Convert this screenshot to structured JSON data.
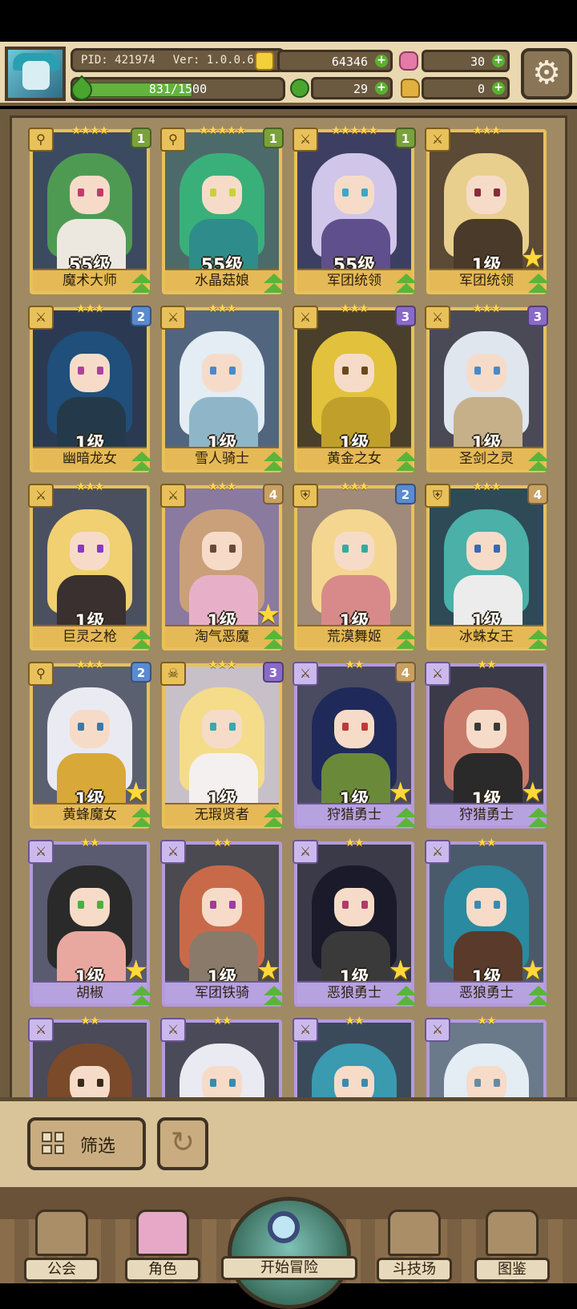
{
  "header": {
    "pid": "PID: 421974",
    "version": "Ver: 1.0.0.6",
    "exp_text": "831/1500",
    "exp_progress": 0.554,
    "resources": {
      "gold": "64346",
      "gems": "30",
      "clover": "29",
      "shoe": "0"
    }
  },
  "roster": [
    {
      "name": "魔术大师",
      "level": "55级",
      "stars": "★★★★",
      "rank": "1",
      "rank_color": "#7aa23c",
      "frame": "gold",
      "type_icon": "wrench",
      "hair": "#4f9a52",
      "body": "#ece8e0",
      "eye": "#c23a6c",
      "bg": "#3b4a60",
      "gold_star": false
    },
    {
      "name": "水晶菇娘",
      "level": "55级",
      "stars": "★★★★★",
      "rank": "1",
      "rank_color": "#7aa23c",
      "frame": "gold",
      "type_icon": "wrench",
      "hair": "#39b07a",
      "body": "#2e8d8a",
      "eye": "#c8d23a",
      "bg": "#4d6a6a",
      "gold_star": false
    },
    {
      "name": "军团统领",
      "level": "55级",
      "stars": "★★★★★",
      "rank": "1",
      "rank_color": "#7aa23c",
      "frame": "gold",
      "type_icon": "sword",
      "hair": "#cfc6ea",
      "body": "#5f4f8c",
      "eye": "#3aa8c8",
      "bg": "#3d3f62",
      "gold_star": false
    },
    {
      "name": "军团统领",
      "level": "1级",
      "stars": "★★★",
      "rank": "",
      "rank_color": "",
      "frame": "gold",
      "type_icon": "sword",
      "hair": "#e8cf8e",
      "body": "#4a3a2a",
      "eye": "#8a2a3a",
      "bg": "#5a4a36",
      "gold_star": true
    },
    {
      "name": "幽暗龙女",
      "level": "1级",
      "stars": "★★★",
      "rank": "2",
      "rank_color": "#5a8ad0",
      "frame": "gold",
      "type_icon": "sword",
      "hair": "#1f4f7a",
      "body": "#243a4a",
      "eye": "#b040a0",
      "bg": "#2b3a52",
      "gold_star": false
    },
    {
      "name": "雪人骑士",
      "level": "1级",
      "stars": "★★★",
      "rank": "",
      "rank_color": "",
      "frame": "gold",
      "type_icon": "sword",
      "hair": "#e4ecf4",
      "body": "#8fb6c8",
      "eye": "#4a8ac8",
      "bg": "#51667e",
      "gold_star": false
    },
    {
      "name": "黄金之女",
      "level": "1级",
      "stars": "★★★",
      "rank": "3",
      "rank_color": "#8a6ac8",
      "frame": "gold",
      "type_icon": "sword",
      "hair": "#e2c23c",
      "body": "#c0a02a",
      "eye": "#6a4a1a",
      "bg": "#4a3f2a",
      "gold_star": false
    },
    {
      "name": "圣剑之灵",
      "level": "1级",
      "stars": "★★★",
      "rank": "3",
      "rank_color": "#8a6ac8",
      "frame": "gold",
      "type_icon": "sword",
      "hair": "#dfe6ee",
      "body": "#c6b08a",
      "eye": "#4a8ac8",
      "bg": "#4a4a56",
      "gold_star": false
    },
    {
      "name": "巨灵之枪",
      "level": "1级",
      "stars": "★★★",
      "rank": "",
      "rank_color": "",
      "frame": "gold",
      "type_icon": "sword",
      "hair": "#f0d070",
      "body": "#3a3030",
      "eye": "#8a3ac0",
      "bg": "#4a5060",
      "gold_star": false
    },
    {
      "name": "淘气恶魔",
      "level": "1级",
      "stars": "★★★",
      "rank": "4",
      "rank_color": "#c8a060",
      "frame": "gold",
      "type_icon": "sword",
      "hair": "#c9a07a",
      "body": "#e8b0c8",
      "eye": "#6a4a3a",
      "bg": "#8a7aa0",
      "gold_star": true
    },
    {
      "name": "荒漠舞姬",
      "level": "1级",
      "stars": "★★★",
      "rank": "2",
      "rank_color": "#5a8ad0",
      "frame": "gold",
      "type_icon": "shield",
      "hair": "#f4d690",
      "body": "#d88a8a",
      "eye": "#3aa8a0",
      "bg": "#a08a7a",
      "gold_star": false
    },
    {
      "name": "冰蛛女王",
      "level": "1级",
      "stars": "★★★",
      "rank": "4",
      "rank_color": "#c8a060",
      "frame": "gold",
      "type_icon": "shield",
      "hair": "#4ab0a8",
      "body": "#ececec",
      "eye": "#3a6ab0",
      "bg": "#2e4a56",
      "gold_star": false
    },
    {
      "name": "黄蜂魔女",
      "level": "1级",
      "stars": "★★★",
      "rank": "2",
      "rank_color": "#5a8ad0",
      "frame": "gold",
      "type_icon": "wrench",
      "hair": "#eaeaf2",
      "body": "#d8a838",
      "eye": "#3a7ab0",
      "bg": "#5a6070",
      "gold_star": true
    },
    {
      "name": "无瑕贤者",
      "level": "1级",
      "stars": "★★★",
      "rank": "3",
      "rank_color": "#8a6ac8",
      "frame": "gold",
      "type_icon": "skull",
      "hair": "#f4dc8a",
      "body": "#f4f0f0",
      "eye": "#3aa8b0",
      "bg": "#c8c0c8",
      "gold_star": false
    },
    {
      "name": "狩猎勇士",
      "level": "1级",
      "stars": "★★",
      "rank": "4",
      "rank_color": "#c8a060",
      "frame": "purple",
      "type_icon": "sword",
      "hair": "#1f2a5a",
      "body": "#6a8a3a",
      "eye": "#c03a3a",
      "bg": "#4a4a60",
      "gold_star": true
    },
    {
      "name": "狩猎勇士",
      "level": "1级",
      "stars": "★★",
      "rank": "",
      "rank_color": "",
      "frame": "purple",
      "type_icon": "sword",
      "hair": "#c87a6a",
      "body": "#2a2a2a",
      "eye": "#3a3a3a",
      "bg": "#3a3a48",
      "gold_star": true
    },
    {
      "name": "胡椒",
      "level": "1级",
      "stars": "★★",
      "rank": "",
      "rank_color": "",
      "frame": "purple",
      "type_icon": "sword",
      "hair": "#2a2a2a",
      "body": "#e8a8a0",
      "eye": "#4ab040",
      "bg": "#5a5a70",
      "gold_star": true
    },
    {
      "name": "军团铁骑",
      "level": "1级",
      "stars": "★★",
      "rank": "",
      "rank_color": "",
      "frame": "purple",
      "type_icon": "sword",
      "hair": "#c86a4a",
      "body": "#8a7a6a",
      "eye": "#a03aa0",
      "bg": "#4a4a50",
      "gold_star": true
    },
    {
      "name": "恶狼勇士",
      "level": "1级",
      "stars": "★★",
      "rank": "",
      "rank_color": "",
      "frame": "purple",
      "type_icon": "sword",
      "hair": "#1a1a2a",
      "body": "#3a3a3a",
      "eye": "#b03a6a",
      "bg": "#3a3a48",
      "gold_star": true
    },
    {
      "name": "恶狼勇士",
      "level": "1级",
      "stars": "★★",
      "rank": "",
      "rank_color": "",
      "frame": "purple",
      "type_icon": "sword",
      "hair": "#2a8aa0",
      "body": "#5a3a2a",
      "eye": "#3a8ab0",
      "bg": "#4a5a6a",
      "gold_star": true
    },
    {
      "name": "",
      "level": "",
      "stars": "★★",
      "rank": "",
      "rank_color": "",
      "frame": "purple",
      "type_icon": "sword",
      "hair": "#7a4a2a",
      "body": "#5a3a2a",
      "eye": "#3a2a1a",
      "bg": "#4a4a58",
      "gold_star": false
    },
    {
      "name": "",
      "level": "",
      "stars": "★★",
      "rank": "",
      "rank_color": "",
      "frame": "purple",
      "type_icon": "sword",
      "hair": "#eaeaf2",
      "body": "#3a3a3a",
      "eye": "#3a8ab0",
      "bg": "#4a4a58",
      "gold_star": false
    },
    {
      "name": "",
      "level": "",
      "stars": "★★",
      "rank": "",
      "rank_color": "",
      "frame": "purple",
      "type_icon": "sword",
      "hair": "#3a9ab0",
      "body": "#3a5a6a",
      "eye": "#3a8ab0",
      "bg": "#3a4a5a",
      "gold_star": false
    },
    {
      "name": "",
      "level": "",
      "stars": "★★",
      "rank": "",
      "rank_color": "",
      "frame": "purple",
      "type_icon": "sword",
      "hair": "#e4ecf4",
      "body": "#c8d8e0",
      "eye": "#6a8aa0",
      "bg": "#6a7a8a",
      "gold_star": false
    }
  ],
  "controls": {
    "filter_label": "筛选"
  },
  "nav": {
    "guild": "公会",
    "characters": "角色",
    "adventure": "开始冒险",
    "arena": "斗技场",
    "codex": "图鉴"
  }
}
